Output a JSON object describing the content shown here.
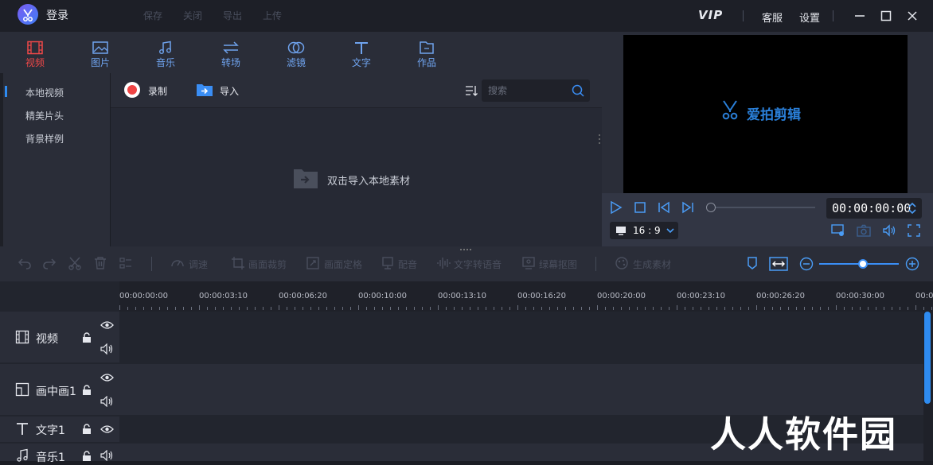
{
  "titlebar": {
    "login": "登录",
    "menu": [
      "保存",
      "关闭",
      "导出",
      "上传"
    ],
    "vip": "VIP",
    "service": "客服",
    "settings": "设置"
  },
  "tabs": [
    {
      "label": "视频",
      "icon": "film-icon",
      "active": true
    },
    {
      "label": "图片",
      "icon": "image-icon",
      "active": false
    },
    {
      "label": "音乐",
      "icon": "music-icon",
      "active": false
    },
    {
      "label": "转场",
      "icon": "transition-icon",
      "active": false
    },
    {
      "label": "滤镜",
      "icon": "filter-icon",
      "active": false
    },
    {
      "label": "文字",
      "icon": "text-icon",
      "active": false
    },
    {
      "label": "作品",
      "icon": "folder-icon",
      "active": false
    }
  ],
  "sidebar": {
    "items": [
      "本地视频",
      "精美片头",
      "背景样例"
    ],
    "selected": 0
  },
  "media": {
    "record_label": "录制",
    "import_label": "导入",
    "search_placeholder": "搜索",
    "empty_hint": "双击导入本地素材"
  },
  "preview": {
    "watermark": "爱拍剪辑",
    "time": "00:00:00:00",
    "aspect_ratio": "16 : 9",
    "seek_progress": 0
  },
  "toolbar": {
    "tools": [
      "调速",
      "画面裁剪",
      "画面定格",
      "配音",
      "文字转语音",
      "绿幕抠图",
      "生成素材"
    ],
    "zoom_level": 0.55
  },
  "timeline": {
    "ruler": [
      "00:00:00:00",
      "00:00:03:10",
      "00:00:06:20",
      "00:00:10:00",
      "00:00:13:10",
      "00:00:16:20",
      "00:00:20:00",
      "00:00:23:10",
      "00:00:26:20",
      "00:00:30:00",
      "00:0"
    ],
    "tracks": [
      {
        "label": "视频",
        "icon": "film-icon"
      },
      {
        "label": "画中画1",
        "icon": "pip-icon"
      },
      {
        "label": "文字1",
        "icon": "text-icon"
      },
      {
        "label": "音乐1",
        "icon": "music-icon"
      }
    ]
  },
  "overlay_watermark": "人人软件园",
  "colors": {
    "accent": "#2e8bf0",
    "active_tab": "#f04848",
    "background": "#1b1d24",
    "panel": "#2a2d38"
  }
}
